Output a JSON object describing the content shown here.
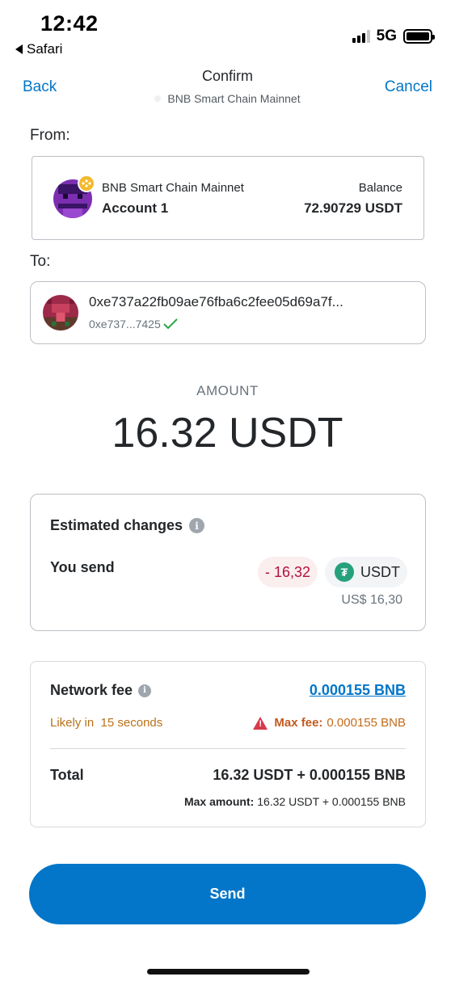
{
  "status": {
    "time": "12:42",
    "back_app": "Safari",
    "network": "5G"
  },
  "header": {
    "back": "Back",
    "title": "Confirm",
    "subtitle": "BNB Smart Chain Mainnet",
    "cancel": "Cancel"
  },
  "from": {
    "label": "From:",
    "network": "BNB Smart Chain Mainnet",
    "account": "Account 1",
    "balance_label": "Balance",
    "balance": "72.90729 USDT"
  },
  "to": {
    "label": "To:",
    "address": "0xe737a22fb09ae76fba6c2fee05d69a7f...",
    "short": "0xe737...7425"
  },
  "amount": {
    "label": "AMOUNT",
    "value": "16.32 USDT"
  },
  "estimated": {
    "title": "Estimated changes",
    "send_label": "You send",
    "change": "- 16,32",
    "token": "USDT",
    "fiat": "US$ 16,30"
  },
  "fee": {
    "title": "Network fee",
    "value": "0.000155 BNB",
    "likely_prefix": "Likely in",
    "likely_time": "15 seconds",
    "max_label": "Max fee:",
    "max_value": "0.000155 BNB",
    "total_label": "Total",
    "total_value": "16.32 USDT + 0.000155 BNB",
    "max_amount_label": "Max amount:",
    "max_amount_value": "16.32 USDT + 0.000155 BNB"
  },
  "actions": {
    "send": "Send"
  },
  "colors": {
    "accent": "#0376c9",
    "negative": "#b1123b",
    "warning": "#c26b1a",
    "tether": "#26a17b",
    "bnb": "#f3ba2f"
  }
}
